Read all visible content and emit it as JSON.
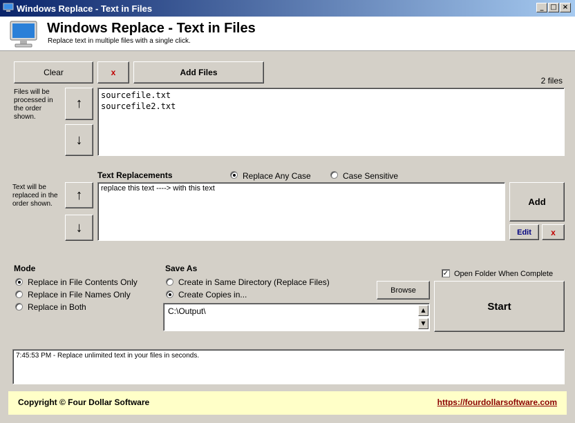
{
  "window": {
    "title": "Windows Replace - Text in Files"
  },
  "header": {
    "title": "Windows Replace - Text in Files",
    "subtitle": "Replace text in multiple files with a single click."
  },
  "files": {
    "clear_label": "Clear",
    "remove_label": "x",
    "add_files_label": "Add Files",
    "count": "2 files",
    "order_note": "Files will be processed in the order shown.",
    "up_label": "↑",
    "down_label": "↓",
    "items": [
      "sourcefile.txt",
      "sourcefile2.txt"
    ]
  },
  "replacements": {
    "heading": "Text Replacements",
    "mode_any_case": "Replace Any Case",
    "mode_case_sensitive": "Case Sensitive",
    "order_note": "Text will be replaced in the order shown.",
    "items": [
      "replace this text ----> with this text"
    ],
    "add_label": "Add",
    "edit_label": "Edit",
    "remove_label": "x",
    "up_label": "↑",
    "down_label": "↓"
  },
  "mode": {
    "heading": "Mode",
    "options": [
      "Replace in File Contents Only",
      "Replace in File Names Only",
      "Replace in Both"
    ],
    "selected_index": 0
  },
  "save_as": {
    "heading": "Save As",
    "option_same_dir": "Create in Same Directory (Replace Files)",
    "option_copies": "Create Copies in...",
    "browse_label": "Browse",
    "output_path": "C:\\Output\\"
  },
  "actions": {
    "open_folder_label": "Open Folder When Complete",
    "open_folder_checked": true,
    "start_label": "Start"
  },
  "log": {
    "text": "7:45:53 PM - Replace unlimited text in your files in seconds."
  },
  "footer": {
    "copyright": "Copyright © Four Dollar Software",
    "link": "https://fourdollarsoftware.com"
  }
}
